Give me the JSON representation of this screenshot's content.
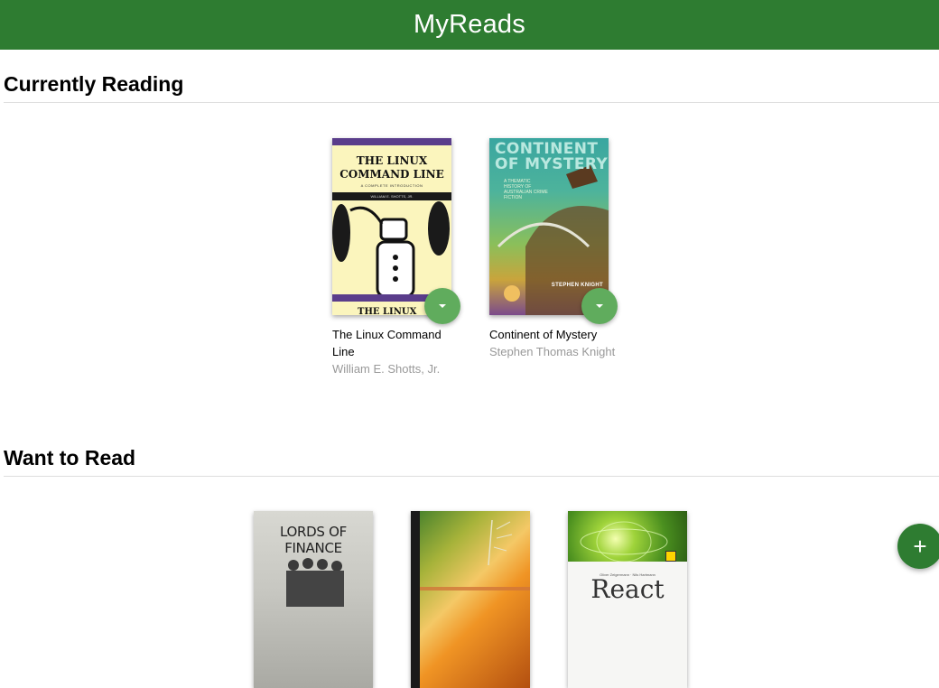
{
  "header": {
    "title": "MyReads"
  },
  "shelves": [
    {
      "title": "Currently Reading",
      "books": [
        {
          "title": "The Linux Command Line",
          "author": "William E. Shotts, Jr.",
          "cover": {
            "title_line1": "THE LINUX",
            "title_line2": "COMMAND LINE",
            "subtitle": "A COMPLETE INTRODUCTION",
            "author_line": "WILLIAM E. SHOTTS, JR."
          }
        },
        {
          "title": "Continent of Mystery",
          "author": "Stephen Thomas Knight",
          "cover": {
            "title_line1": "CONTINENT",
            "title_line2": "OF MYSTERY",
            "subtitle": "A THEMATIC HISTORY OF AUSTRALIAN CRIME FICTION",
            "author_line": "STEPHEN KNIGHT"
          }
        }
      ]
    },
    {
      "title": "Want to Read",
      "books": [
        {
          "cover": {
            "title": "LORDS OF FINANCE"
          }
        },
        {
          "cover": {}
        },
        {
          "cover": {
            "authors": "Oliver Zeigermann · Nils Hartmann",
            "title": "React"
          }
        }
      ]
    }
  ],
  "add_button": {
    "label": "+"
  },
  "colors": {
    "header_bg": "#2e7c31",
    "shelf_menu_button": "#60ac5d",
    "add_button_bg": "#2e7c31"
  },
  "icons": {
    "shelf_changer": "caret-down-icon",
    "add": "plus-icon"
  }
}
